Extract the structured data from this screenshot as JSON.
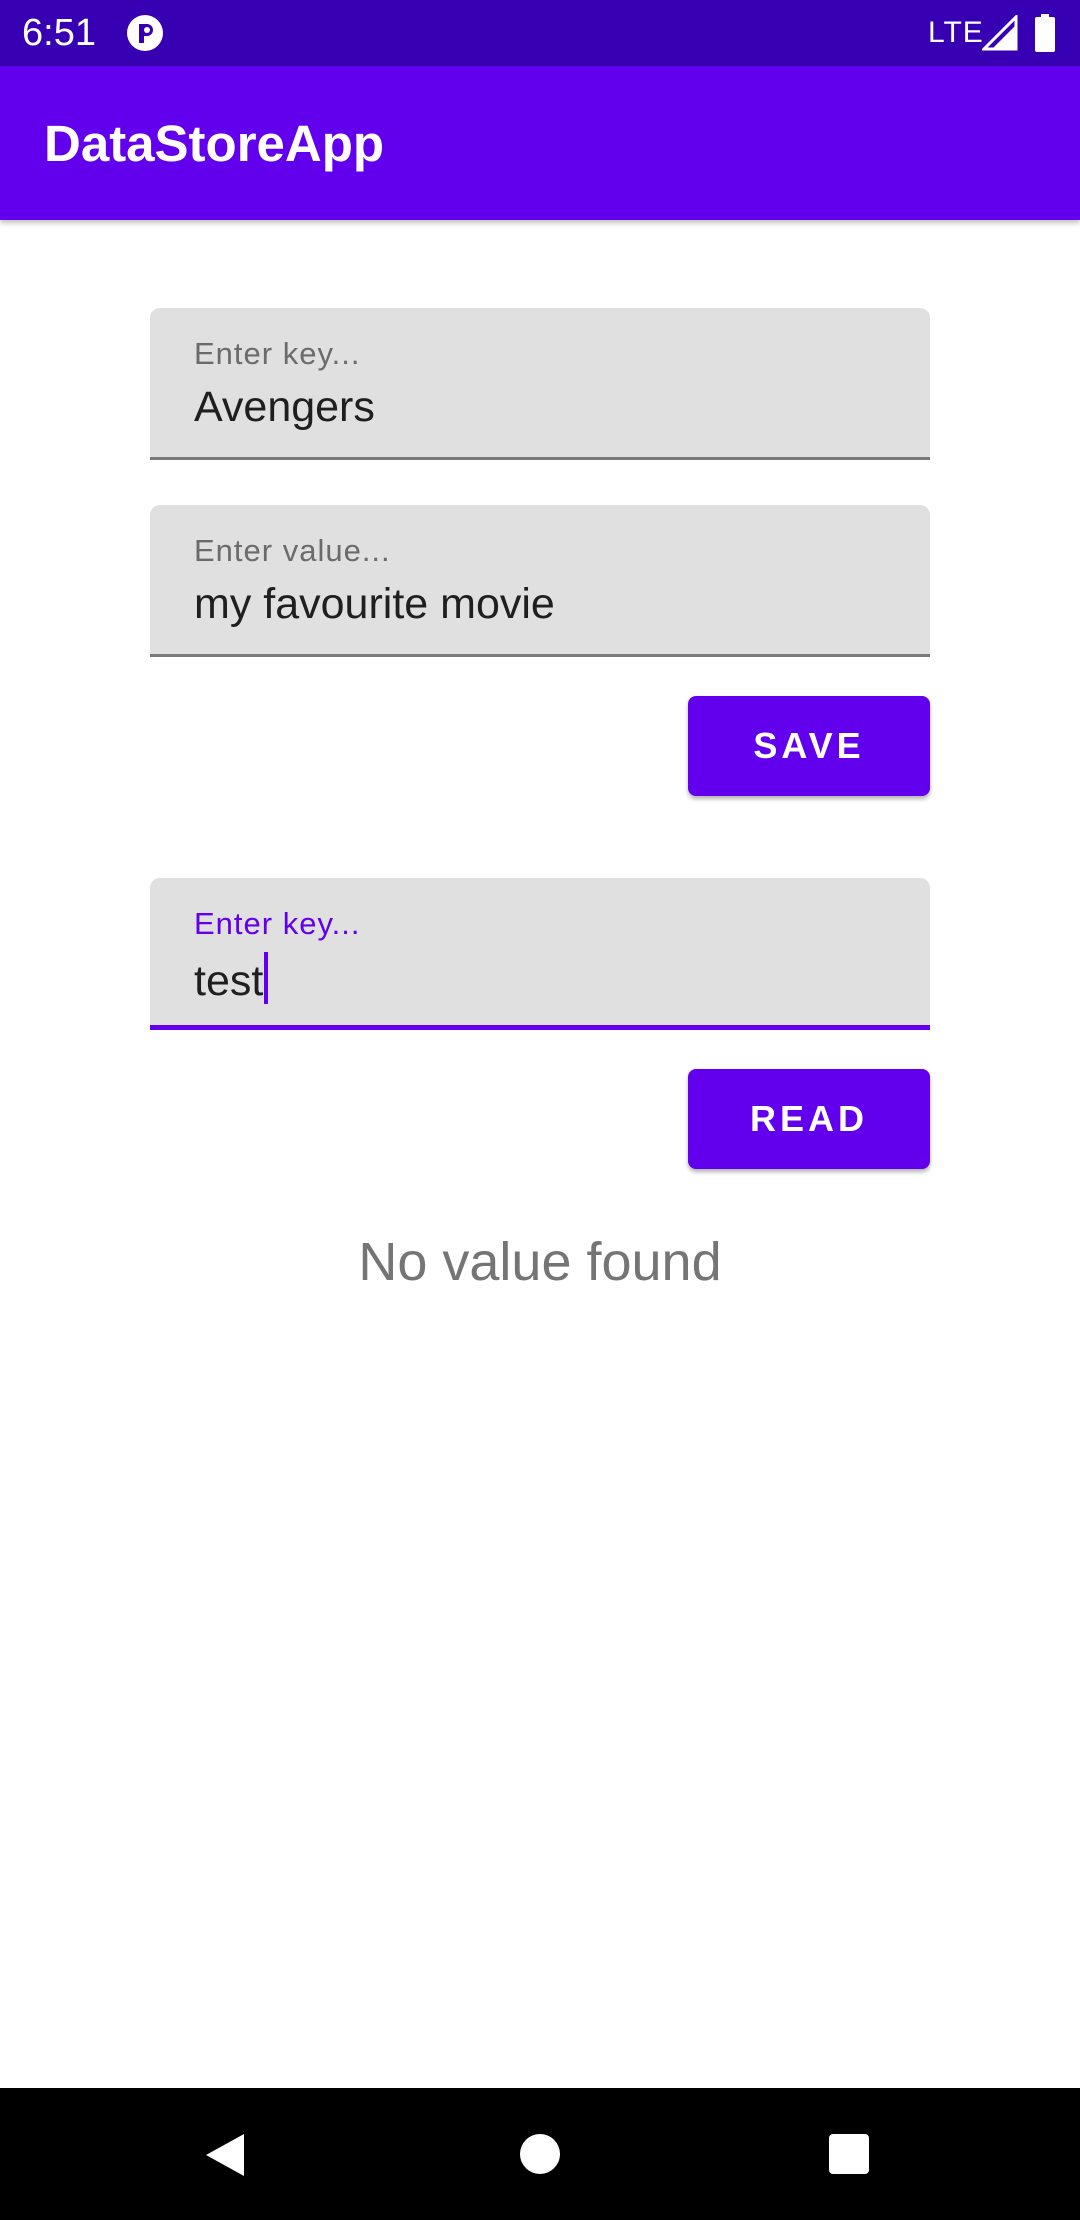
{
  "status_bar": {
    "time": "6:51",
    "network": "LTE",
    "icons": [
      "notification-app-icon",
      "signal-icon",
      "battery-icon"
    ]
  },
  "app_bar": {
    "title": "DataStoreApp"
  },
  "save_section": {
    "key_field": {
      "label": "Enter key...",
      "value": "Avengers"
    },
    "value_field": {
      "label": "Enter value...",
      "value": "my favourite movie"
    },
    "save_button": "SAVE"
  },
  "read_section": {
    "key_field": {
      "label": "Enter key...",
      "value": "test",
      "focused": true
    },
    "read_button": "READ",
    "result": "No value found"
  },
  "nav_bar": {
    "icons": [
      "back-icon",
      "home-icon",
      "recents-icon"
    ]
  },
  "colors": {
    "primary": "#6200EE",
    "primary_dark": "#3700B3",
    "field_background": "#E0E0E0",
    "result_text": "#757575"
  }
}
